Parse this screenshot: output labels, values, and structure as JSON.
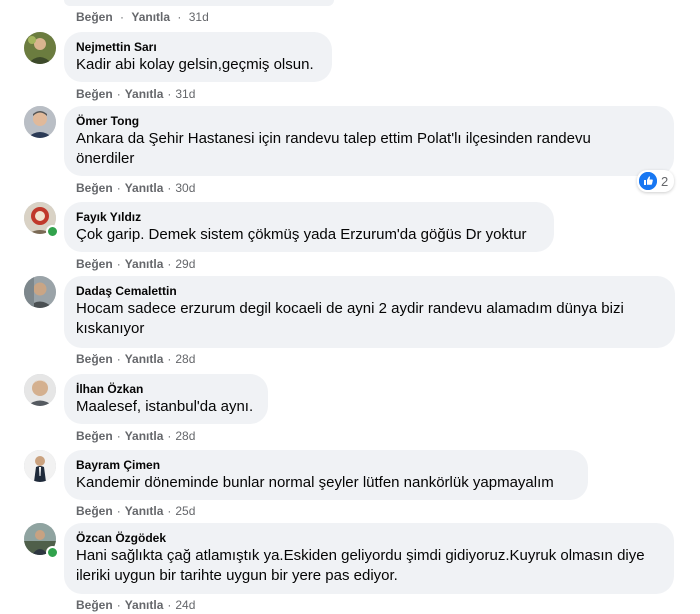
{
  "actions": {
    "like": "Beğen",
    "reply": "Yanıtla",
    "separator": "·"
  },
  "top_comment_tail": {
    "time": "31d"
  },
  "comments": [
    {
      "author": "Nejmettin Sarı",
      "text": "Kadir abi kolay gelsin,geçmiş olsun.",
      "time": "31d"
    },
    {
      "author": "Ömer Tong",
      "text": "Ankara da Şehir Hastanesi için randevu talep ettim Polat'lı ilçesinden randevu önerdiler",
      "time": "30d",
      "reaction_count": "2"
    },
    {
      "author": "Fayık Yıldız",
      "text": "Çok garip. Demek sistem çökmüş yada Erzurum'da göğüs Dr yoktur",
      "time": "29d",
      "online": true
    },
    {
      "author": "Dadaş Cemalettin",
      "text": "Hocam sadece erzurum degil kocaeli de ayni 2 aydir randevu alamadım dünya bizi kıskanıyor",
      "time": "28d"
    },
    {
      "author": "İlhan Özkan",
      "text": "Maalesef, istanbul'da aynı.",
      "time": "28d"
    },
    {
      "author": "Bayram Çimen",
      "text": "Kandemir döneminde bunlar normal şeyler lütfen nankörlük yapmayalım",
      "time": "25d"
    },
    {
      "author": "Özcan Özgödek",
      "text": "Hani sağlıkta çağ atlamıştık ya.Eskiden geliyordu şimdi gidiyoruz.Kuyruk olmasın diye ileriki uygun bir tarihte uygun bir yere pas ediyor.",
      "time": "24d",
      "online": true
    }
  ],
  "colors": {
    "bubble": "#f0f2f5",
    "meta_text": "#65676b",
    "online": "#31a24c",
    "like_blue": "#1877f2"
  }
}
